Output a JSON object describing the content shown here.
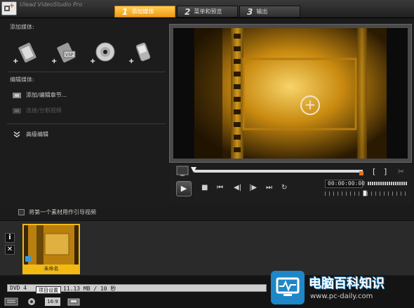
{
  "app": {
    "title": "Ulead VideoStudio Pro"
  },
  "steps": [
    {
      "num": "1",
      "label": "添加媒体",
      "active": true
    },
    {
      "num": "2",
      "label": "菜单和预览",
      "active": false
    },
    {
      "num": "3",
      "label": "输出",
      "active": false
    }
  ],
  "left_panel": {
    "add_media_label": "添加媒体:",
    "edit_media_label": "编辑媒体:",
    "media_buttons": [
      {
        "name": "add-video-button",
        "icon": "video-clip-icon",
        "plus": "+"
      },
      {
        "name": "add-vsp-project-button",
        "icon": "vsp-project-icon",
        "plus": "+"
      },
      {
        "name": "add-disc-button",
        "icon": "dvd-disc-icon",
        "plus": "+"
      },
      {
        "name": "add-mobile-device-button",
        "icon": "mobile-device-icon",
        "plus": "+"
      }
    ],
    "edit_items": [
      {
        "label": "添加/编辑章节...",
        "enabled": true,
        "icon": "film-chapter-icon"
      },
      {
        "label": "连接/分割视频",
        "enabled": false,
        "icon": "split-video-icon"
      }
    ],
    "advanced_label": "高级编辑",
    "advanced_icon": "double-chevron-down-icon"
  },
  "player": {
    "timecode": "00:00:00:00",
    "bracket_in": "[",
    "bracket_out": "]",
    "controls": [
      "play",
      "stop",
      "home",
      "prev-frame",
      "next-frame",
      "end",
      "repeat"
    ]
  },
  "intro_checkbox": {
    "label": "将第一个素材用作引导视频",
    "checked": false
  },
  "storyboard": {
    "clips": [
      {
        "caption": "未命名"
      }
    ],
    "info_btn": "i",
    "delete_btn": "✕"
  },
  "status": {
    "progress_text_left": "DVD 4",
    "progress_text_right": "11.13 MB / 10 秒",
    "progress_fraction": 0.0,
    "tooltip": "项目设置",
    "aspect_label": "16:9"
  },
  "watermark": {
    "title": "电脑百科知识",
    "url": "www.pc-daily.com"
  },
  "colors": {
    "accent": "#f2b913",
    "tab_active": "#f09a14",
    "watermark_blue": "#1f86c7"
  }
}
